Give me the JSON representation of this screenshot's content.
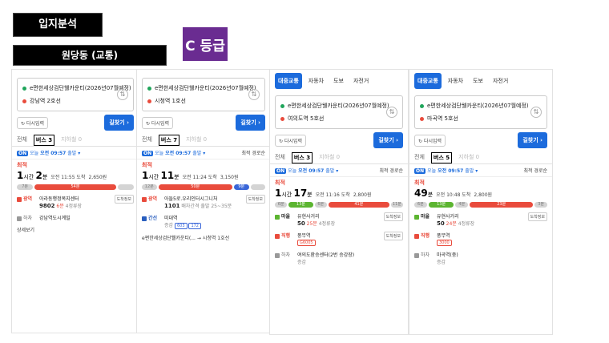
{
  "header": {
    "title": "입지분석",
    "subtitle": "원당동 (교통)",
    "grade": "C 등급"
  },
  "panels": [
    {
      "mode_tabs": [],
      "origin": "e편한세상검단웰카운티(2026년07월예정)",
      "destination": "강남역 2호선",
      "reset_label": "다시입력",
      "search_label": "길찾기",
      "filters": [
        "전체",
        "버스 3",
        "지하철 0"
      ],
      "active_filter": 1,
      "depart": {
        "on": "ON",
        "prefix": "오늘",
        "time": "오전 09:57",
        "suffix": "출발"
      },
      "sort": "",
      "best_label": "최적",
      "duration_h": "1",
      "duration_m": "2",
      "arrival": "오전 11:55 도착",
      "fare": "2,650원",
      "bar": [
        {
          "type": "walk",
          "label": "7분"
        },
        {
          "type": "red",
          "label": "54분"
        },
        {
          "type": "walk",
          "label": ""
        }
      ],
      "steps": [
        {
          "mode": "광역",
          "color": "red",
          "stop": "아라동행정복지센터",
          "bus": "9802",
          "wait": "6분",
          "stops": "4정류장",
          "btn": "도착정보"
        },
        {
          "mode": "하차",
          "color": "gray",
          "stop": "강남역도시계빌",
          "bus": "",
          "wait": "",
          "stops": "",
          "btn": ""
        }
      ],
      "footer": "상세보기"
    },
    {
      "mode_tabs": [],
      "origin": "e편한세상검단웰카운티(2026년07월예정)",
      "destination": "시청역 1호선",
      "reset_label": "다시입력",
      "search_label": "길찾기",
      "filters": [
        "전체",
        "버스 7",
        "지하철 0"
      ],
      "active_filter": 1,
      "depart": {
        "on": "ON",
        "prefix": "오늘",
        "time": "오전 09:57",
        "suffix": "출발"
      },
      "sort": "최적 경로순",
      "best_label": "최적",
      "duration_h": "1",
      "duration_m": "11",
      "arrival": "오전 11:24 도착",
      "fare": "3,150원",
      "bar": [
        {
          "type": "walk",
          "label": "12분"
        },
        {
          "type": "red",
          "label": "50분"
        },
        {
          "type": "blue",
          "label": "9분"
        },
        {
          "type": "walk",
          "label": ""
        }
      ],
      "steps": [
        {
          "mode": "광역",
          "color": "red",
          "stop": "아들5로.우리인터시그니처",
          "bus": "1101",
          "wait": "",
          "stops": "배차간격 출발 25~35분",
          "btn": "도착정보"
        },
        {
          "mode": "간선",
          "color": "blue",
          "stop": "미대역",
          "bus": "",
          "wait": "",
          "stops": "증감",
          "btn": "",
          "chips": [
            "603",
            "172"
          ]
        }
      ],
      "footer": "e편한세상검단웰카운티(... → 시청역 1호선"
    },
    {
      "mode_tabs": [
        "대중교통",
        "자동차",
        "도보",
        "자전거"
      ],
      "origin": "e편한세상검단웰카운티(2026년07월예정)",
      "destination": "여의도역 5호선",
      "reset_label": "다시입력",
      "search_label": "길찾기",
      "filters": [
        "전체",
        "버스 3",
        "지하철 0"
      ],
      "active_filter": 1,
      "depart": {
        "on": "ON",
        "prefix": "오늘",
        "time": "오전 09:57",
        "suffix": "출발"
      },
      "sort": "최적 경로순",
      "best_label": "최적",
      "duration_h": "1",
      "duration_m": "17",
      "arrival": "오전 11:16 도착",
      "fare": "2,800원",
      "bar": [
        {
          "type": "walk",
          "label": "6분"
        },
        {
          "type": "green",
          "label": "13분"
        },
        {
          "type": "walk",
          "label": "6분"
        },
        {
          "type": "red",
          "label": "41분"
        },
        {
          "type": "walk",
          "label": "11분"
        }
      ],
      "steps": [
        {
          "mode": "마을",
          "color": "green",
          "stop": "유현사거리",
          "bus": "50",
          "wait": "25분",
          "stops": "4정류장",
          "btn": "도착정보"
        },
        {
          "mode": "직행",
          "color": "red",
          "stop": "풍무역",
          "bus": "",
          "wait": "",
          "stops": "",
          "btn": "도착정보",
          "chips": [
            "G6005"
          ]
        },
        {
          "mode": "하차",
          "color": "gray",
          "stop": "여의도환승센터(2번 승강장)",
          "bus": "",
          "wait": "",
          "stops": "증감",
          "btn": ""
        }
      ],
      "footer": ""
    },
    {
      "mode_tabs": [
        "대중교통",
        "자동차",
        "도보",
        "자전거"
      ],
      "origin": "e편한세상검단웰카운티(2026년07월예정)",
      "destination": "마곡역 5호선",
      "reset_label": "다시입력",
      "search_label": "길찾기",
      "filters": [
        "전체",
        "버스 5",
        "지하철 0"
      ],
      "active_filter": 1,
      "depart": {
        "on": "ON",
        "prefix": "오늘",
        "time": "오전 09:57",
        "suffix": "출발"
      },
      "sort": "최적 경로순",
      "best_label": "최적",
      "duration_h": "",
      "duration_m": "49",
      "arrival": "오전 10:48 도착",
      "fare": "2,800원",
      "bar": [
        {
          "type": "walk",
          "label": "6분"
        },
        {
          "type": "green",
          "label": "13분"
        },
        {
          "type": "walk",
          "label": "4분"
        },
        {
          "type": "red",
          "label": "23분"
        },
        {
          "type": "walk",
          "label": "3분"
        }
      ],
      "steps": [
        {
          "mode": "마을",
          "color": "green",
          "stop": "유현사거리",
          "bus": "50",
          "wait": "24분",
          "stops": "4정류장",
          "btn": "도착정보"
        },
        {
          "mode": "직행",
          "color": "red",
          "stop": "풍무역",
          "bus": "",
          "wait": "",
          "stops": "",
          "btn": "",
          "chips": [
            "3000"
          ]
        },
        {
          "mode": "하차",
          "color": "gray",
          "stop": "마곡역(중)",
          "bus": "",
          "wait": "",
          "stops": "증감",
          "btn": ""
        }
      ],
      "footer": ""
    }
  ]
}
